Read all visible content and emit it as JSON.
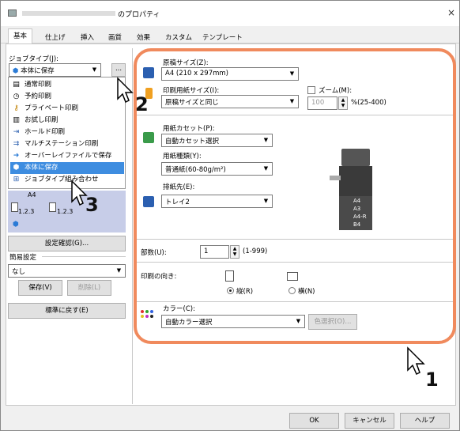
{
  "window": {
    "title_suffix": "のプロパティ",
    "close_glyph": "×"
  },
  "tabs": [
    {
      "label": "基本",
      "active": true
    },
    {
      "label": "仕上げ"
    },
    {
      "label": "挿入"
    },
    {
      "label": "画質"
    },
    {
      "label": "効果"
    },
    {
      "label": "カスタム"
    },
    {
      "label": "テンプレート"
    }
  ],
  "job": {
    "label": "ジョブタイプ(J):",
    "value": "本体に保存",
    "more_button": "...",
    "list": [
      {
        "label": "通常印刷",
        "icon": "document-icon"
      },
      {
        "label": "予約印刷",
        "icon": "clock-icon"
      },
      {
        "label": "プライベート印刷",
        "icon": "key-icon"
      },
      {
        "label": "お試し印刷",
        "icon": "copies-icon"
      },
      {
        "label": "ホールド印刷",
        "icon": "hold-icon"
      },
      {
        "label": "マルチステーション印刷",
        "icon": "multistation-icon"
      },
      {
        "label": "オーバーレイファイルで保存",
        "icon": "overlay-icon"
      },
      {
        "label": "本体に保存",
        "icon": "store-icon",
        "selected": true
      },
      {
        "label": "ジョブタイプ組み合わせ",
        "icon": "combine-icon"
      }
    ]
  },
  "preview": {
    "paper": "A4",
    "count_a": "1.2.3",
    "count_b": "1.2.3"
  },
  "settings_check_button": "設定確認(G)...",
  "easy": {
    "label": "簡易設定",
    "value": "なし",
    "save_button": "保存(V)",
    "delete_button": "削除(L)"
  },
  "restore_button": "標準に戻す(E)",
  "original_size": {
    "label": "原稿サイズ(Z):",
    "value": "A4 (210 x 297mm)"
  },
  "print_size": {
    "label": "印刷用紙サイズ(I):",
    "value": "原稿サイズと同じ"
  },
  "zoom": {
    "label": "ズーム(M):",
    "value": "100",
    "range": "%(25-400)"
  },
  "cassette": {
    "label": "用紙カセット(P):",
    "value": "自動カセット選択"
  },
  "paper_type": {
    "label": "用紙種類(Y):",
    "value": "普通紙(60-80g/m²)"
  },
  "output": {
    "label": "排紙先(E):",
    "value": "トレイ2"
  },
  "printer_trays": [
    "A4",
    "A3",
    "A4-R",
    "B4"
  ],
  "copies": {
    "label": "部数(U):",
    "value": "1",
    "range": "(1-999)"
  },
  "orientation": {
    "label": "印刷の向き:",
    "portrait": "縦(R)",
    "landscape": "横(N)"
  },
  "color": {
    "label": "カラー(C):",
    "value": "自動カラー選択",
    "select_button": "色選択(O)..."
  },
  "footer": {
    "ok": "OK",
    "cancel": "キャンセル",
    "help": "ヘルプ"
  },
  "callouts": {
    "one": "1",
    "two": "2",
    "three": "3"
  },
  "colors": {
    "highlight": "#f08a5d",
    "selection": "#3e8de0",
    "preview_bg": "#c7cde8"
  }
}
